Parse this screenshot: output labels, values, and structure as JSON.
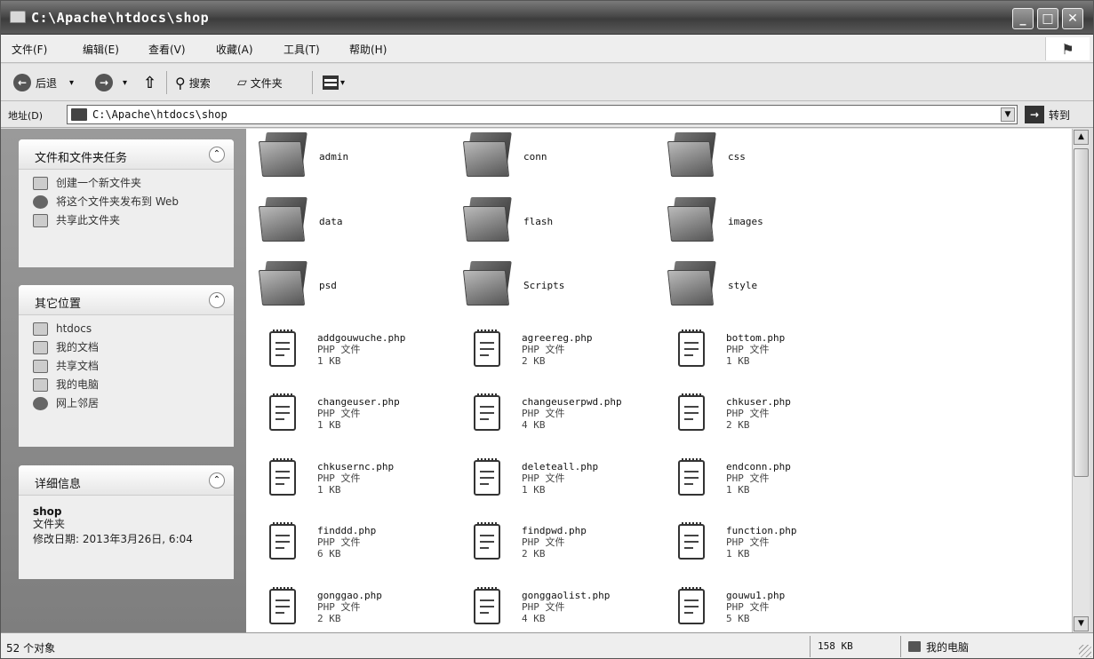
{
  "window": {
    "title": "C:\\Apache\\htdocs\\shop"
  },
  "menu": {
    "items": [
      "文件(F)",
      "编辑(E)",
      "查看(V)",
      "收藏(A)",
      "工具(T)",
      "帮助(H)"
    ]
  },
  "toolbar": {
    "back_label": "后退",
    "search_label": "搜索",
    "folders_label": "文件夹"
  },
  "address": {
    "label": "地址(D)",
    "path": "C:\\Apache\\htdocs\\shop",
    "go_label": "转到"
  },
  "tasks_panel": {
    "title": "文件和文件夹任务",
    "items": [
      "创建一个新文件夹",
      "将这个文件夹发布到 Web",
      "共享此文件夹"
    ]
  },
  "places_panel": {
    "title": "其它位置",
    "items": [
      "htdocs",
      "我的文档",
      "共享文档",
      "我的电脑",
      "网上邻居"
    ]
  },
  "details_panel": {
    "title": "详细信息",
    "name": "shop",
    "type": "文件夹",
    "modified": "修改日期: 2013年3月26日, 6:04"
  },
  "folders": [
    "admin",
    "conn",
    "css",
    "data",
    "flash",
    "images",
    "psd",
    "Scripts",
    "style"
  ],
  "files": [
    {
      "name": "addgouwuche.php",
      "type": "PHP 文件",
      "size": "1 KB"
    },
    {
      "name": "agreereg.php",
      "type": "PHP 文件",
      "size": "2 KB"
    },
    {
      "name": "bottom.php",
      "type": "PHP 文件",
      "size": "1 KB"
    },
    {
      "name": "changeuser.php",
      "type": "PHP 文件",
      "size": "1 KB"
    },
    {
      "name": "changeuserpwd.php",
      "type": "PHP 文件",
      "size": "4 KB"
    },
    {
      "name": "chkuser.php",
      "type": "PHP 文件",
      "size": "2 KB"
    },
    {
      "name": "chkusernc.php",
      "type": "PHP 文件",
      "size": "1 KB"
    },
    {
      "name": "deleteall.php",
      "type": "PHP 文件",
      "size": "1 KB"
    },
    {
      "name": "endconn.php",
      "type": "PHP 文件",
      "size": "1 KB"
    },
    {
      "name": "finddd.php",
      "type": "PHP 文件",
      "size": "6 KB"
    },
    {
      "name": "findpwd.php",
      "type": "PHP 文件",
      "size": "2 KB"
    },
    {
      "name": "function.php",
      "type": "PHP 文件",
      "size": "1 KB"
    },
    {
      "name": "gonggao.php",
      "type": "PHP 文件",
      "size": "2 KB"
    },
    {
      "name": "gonggaolist.php",
      "type": "PHP 文件",
      "size": "4 KB"
    },
    {
      "name": "gouwu1.php",
      "type": "PHP 文件",
      "size": "5 KB"
    }
  ],
  "status": {
    "count": "52 个对象",
    "size": "158 KB",
    "zone": "我的电脑"
  }
}
